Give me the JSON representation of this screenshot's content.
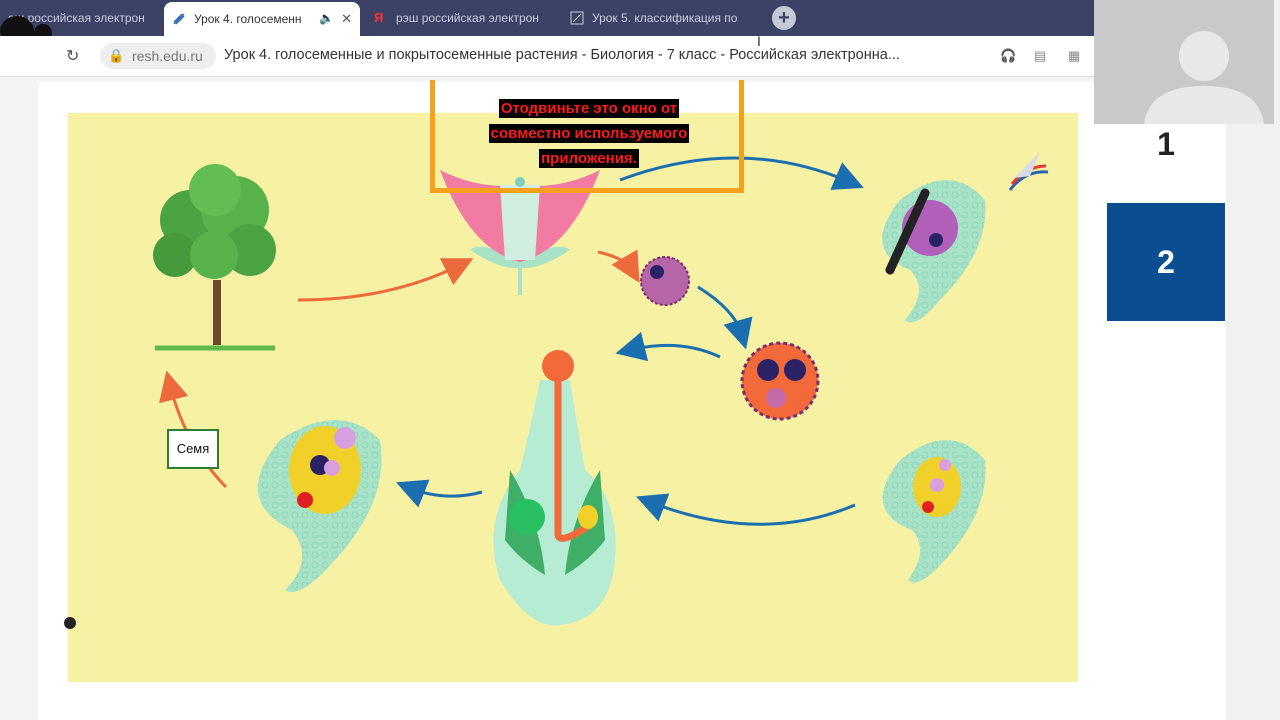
{
  "browser": {
    "tabs": [
      {
        "label": "ош российская электрон",
        "active": false,
        "favicon": "app-icon"
      },
      {
        "label": "Урок 4. голосеменн",
        "active": true,
        "favicon": "resh-icon"
      },
      {
        "label": "рэш российская электрон",
        "active": false,
        "favicon": "yandex-icon"
      },
      {
        "label": "Урок 5. классификация по",
        "active": false,
        "favicon": "resh-icon"
      }
    ],
    "new_tab": "+",
    "domain": "resh.edu.ru",
    "page_title": "Урок 4. голосеменные и покрытосеменные растения - Биология - 7 класс - Российская электронна..."
  },
  "overlay": {
    "warning_lines": [
      "Отодвиньте это окно от",
      "совместно используемого",
      "приложения."
    ]
  },
  "lesson": {
    "seed_label": "Семя"
  },
  "side_panel": {
    "slide_1": "1",
    "slide_2": "2"
  },
  "colors": {
    "stage_bg": "#f7f2a3",
    "accent_blue": "#0a4e8f",
    "warning_red": "#ff1a1a",
    "frame_orange": "#f6a11d"
  }
}
